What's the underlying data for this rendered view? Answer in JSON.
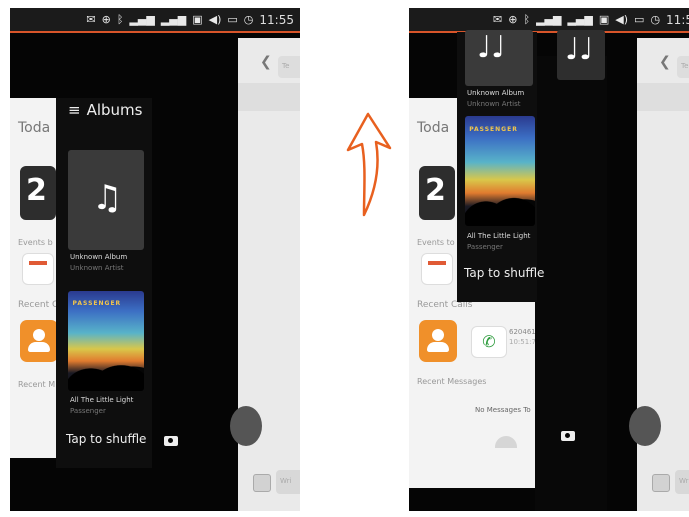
{
  "status": {
    "time": "11:55",
    "time_cut": "11:5"
  },
  "today": {
    "title": "Toda",
    "day_number": "2",
    "events_label": "Events b",
    "events_label_right": "Events to",
    "recent_calls_label": "Recent C",
    "recent_calls_full": "Recent Calls",
    "recent_messages_label": "Recent M",
    "recent_messages_full": "Recent Messages",
    "call_number": "620461",
    "call_time": "10:51:7",
    "no_messages": "No Messages To"
  },
  "music": {
    "header": "Albums",
    "album1_title": "Unknown Album",
    "album1_artist": "Unknown Artist",
    "album2_title": "All The Little Light",
    "album2_artist": "Passenger",
    "album2_band_text": "PASSENGER",
    "shuffle": "Tap to shuffle",
    "note_glyph": "♫",
    "note_glyph_double": "♩♩"
  },
  "messages": {
    "back": "❮",
    "field_hint": "Te",
    "bottom_hint": "Wri"
  },
  "colors": {
    "accent": "#e8601f",
    "avatar": "#f0902a",
    "status_underline": "#d8552a"
  }
}
